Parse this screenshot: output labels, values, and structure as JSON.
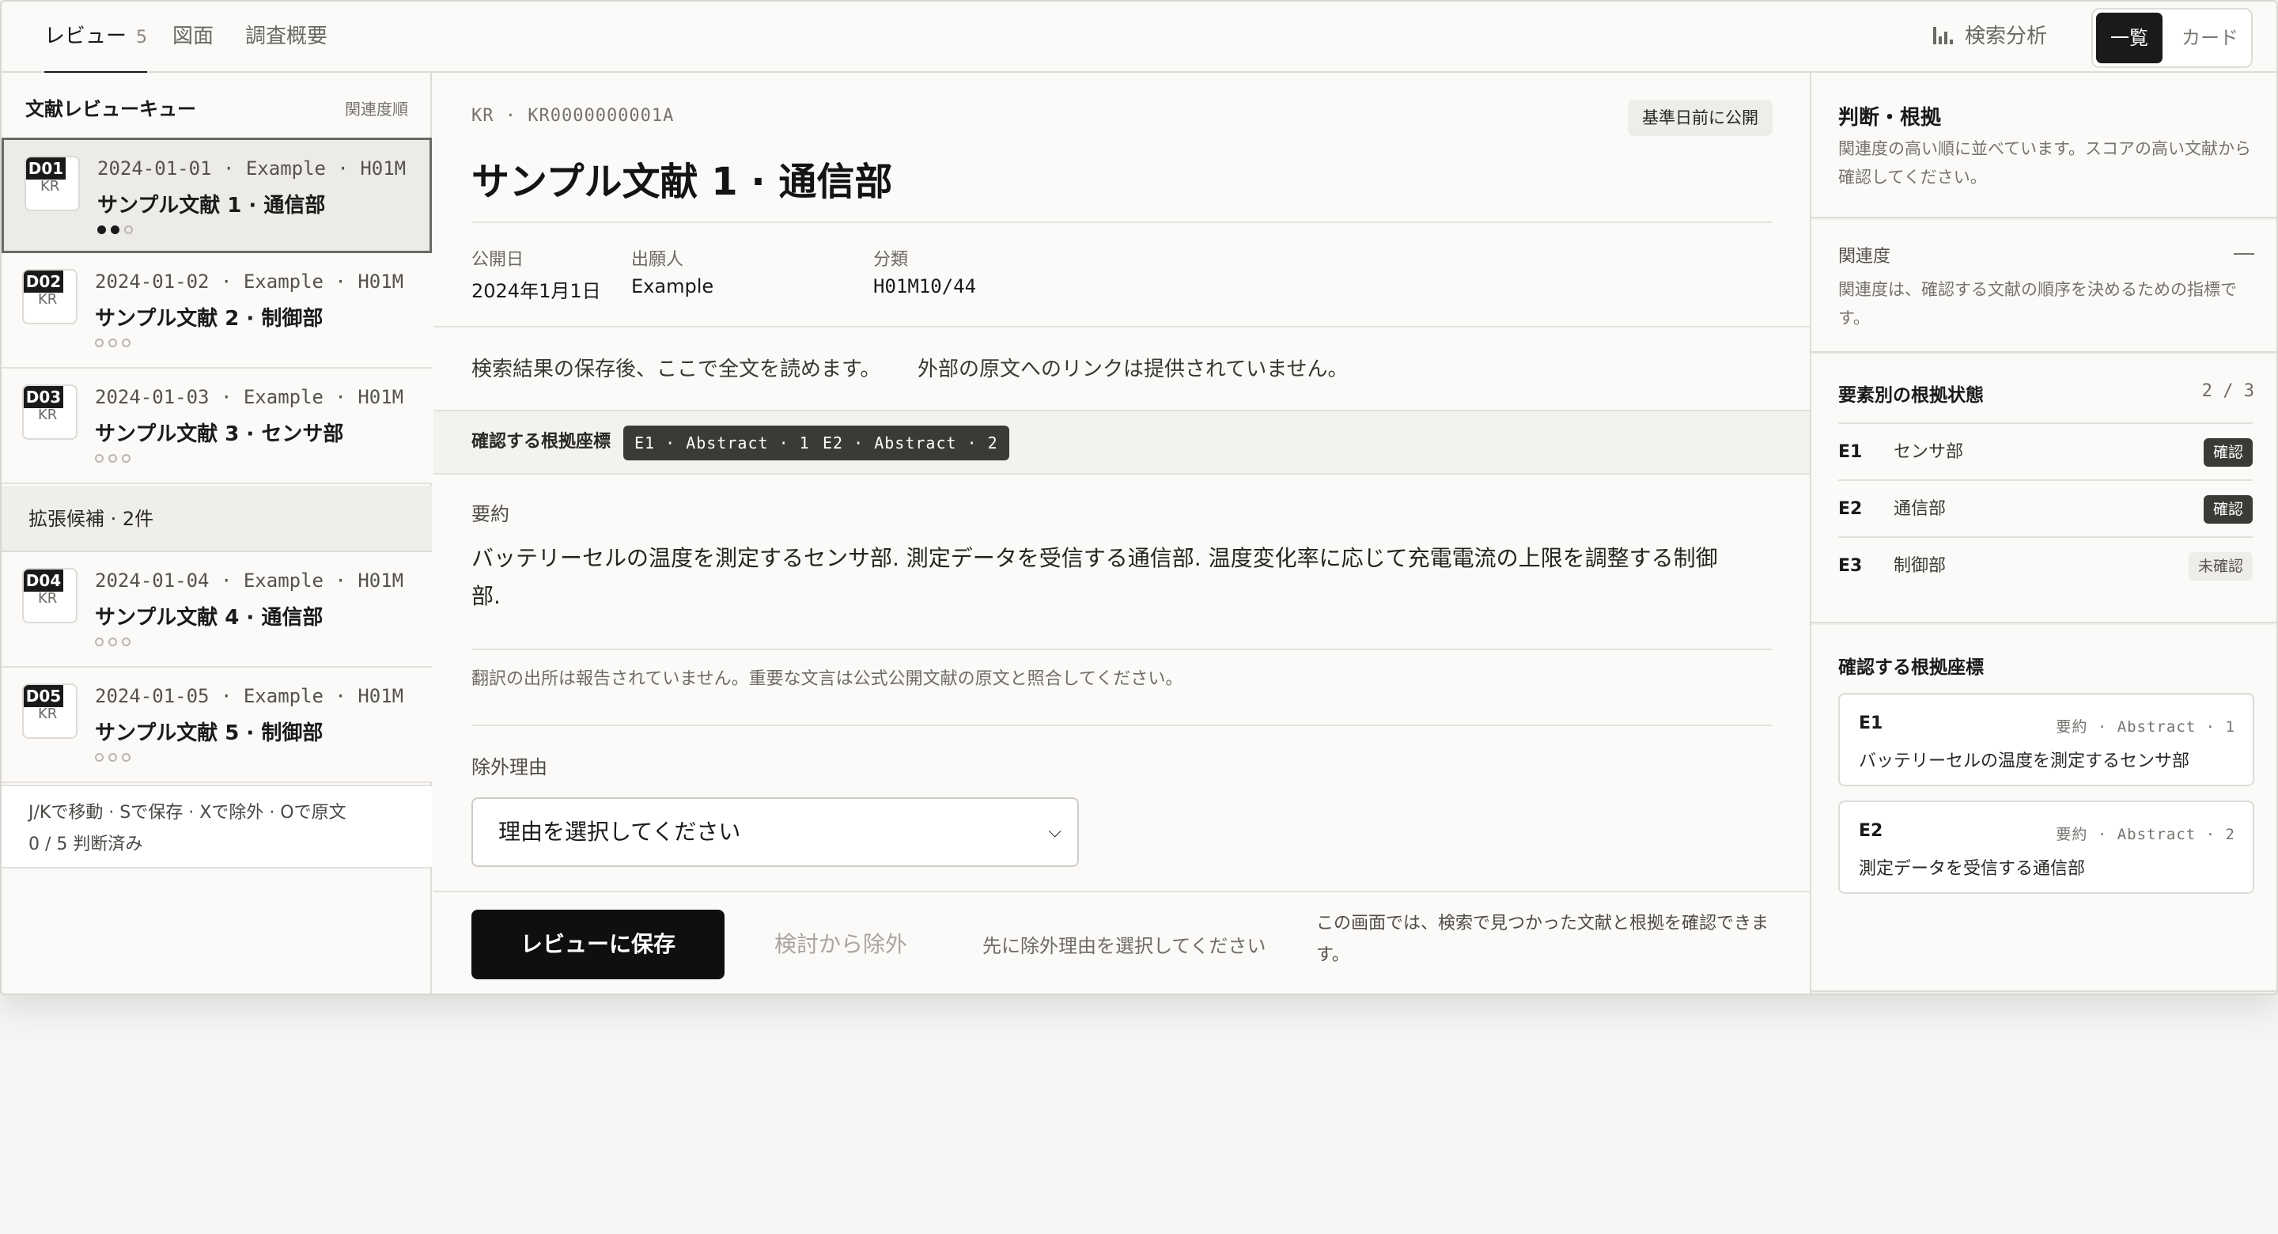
{
  "tabs": [
    {
      "label": "レビュー",
      "count": "5"
    },
    {
      "label": "図面"
    },
    {
      "label": "調査概要"
    }
  ],
  "header": {
    "analysis_label": "検索分析",
    "view_list": "一覧",
    "view_card": "カード"
  },
  "queue": {
    "title": "文献レビューキュー",
    "sort": "関連度順",
    "group_label": "拡張候補 · 2件",
    "items": [
      {
        "code": "D01",
        "country": "KR",
        "meta": "2024-01-01 · Example · H01M",
        "title": "サンプル文献 1 · 通信部",
        "progress": 2,
        "total": 3
      },
      {
        "code": "D02",
        "country": "KR",
        "meta": "2024-01-02 · Example · H01M",
        "title": "サンプル文献 2 · 制御部",
        "progress": 0,
        "total": 3
      },
      {
        "code": "D03",
        "country": "KR",
        "meta": "2024-01-03 · Example · H01M",
        "title": "サンプル文献 3 · センサ部",
        "progress": 0,
        "total": 3
      },
      {
        "code": "D04",
        "country": "KR",
        "meta": "2024-01-04 · Example · H01M",
        "title": "サンプル文献 4 · 通信部",
        "progress": 0,
        "total": 3
      },
      {
        "code": "D05",
        "country": "KR",
        "meta": "2024-01-05 · Example · H01M",
        "title": "サンプル文献 5 · 制御部",
        "progress": 0,
        "total": 3
      }
    ],
    "footer_shortcuts": "J/Kで移動 · Sで保存 · Xで除外 · Oで原文",
    "footer_progress": "0 / 5 判断済み"
  },
  "doc": {
    "crumb": "KR · KR0000000001A",
    "badge": "基準日前に公開",
    "title": "サンプル文献 1 · 通信部",
    "fields": [
      {
        "label": "公開日",
        "value": "2024年1月1日"
      },
      {
        "label": "出願人",
        "value": "Example"
      },
      {
        "label": "分類",
        "value": "H01M10/44"
      }
    ],
    "notice_1": "検索結果の保存後、ここで全文を読めます。",
    "notice_2": "外部の原文へのリンクは提供されていません。",
    "evidence_label": "確認する根拠座標",
    "chips": [
      "E1 · Abstract · 1",
      "E2 · Abstract · 2"
    ],
    "abstract_label": "要約",
    "abstract": "バッテリーセルの温度を測定するセンサ部. 測定データを受信する通信部. 温度変化率に応じて充電電流の上限を調整する制御部.",
    "translation_note": "翻訳の出所は報告されていません。重要な文言は公式公開文献の原文と照合してください。",
    "exclusion_label": "除外理由",
    "exclusion_placeholder": "理由を選択してください"
  },
  "actions": {
    "save": "レビューに保存",
    "exclude": "検討から除外",
    "hint": "先に除外理由を選択してください",
    "note": "この画面では、検索で見つかった文献と根拠を確認できます。"
  },
  "panel": {
    "title": "判断・根拠",
    "subtitle": "関連度の高い順に並べています。スコアの高い文献から確認してください。",
    "relevance_label": "関連度",
    "relevance_desc": "関連度は、確認する文献の順序を決めるための指標です。",
    "elements_title": "要素別の根拠状態",
    "elements_count": "2 / 3",
    "elements": [
      {
        "id": "E1",
        "name": "センサ部",
        "status": "確認",
        "ok": true
      },
      {
        "id": "E2",
        "name": "通信部",
        "status": "確認",
        "ok": true
      },
      {
        "id": "E3",
        "name": "制御部",
        "status": "未確認",
        "ok": false
      }
    ],
    "coords_title": "確認する根拠座標",
    "coords": [
      {
        "id": "E1",
        "source": "要約 · Abstract · 1",
        "text": "バッテリーセルの温度を測定するセンサ部"
      },
      {
        "id": "E2",
        "source": "要約 · Abstract · 2",
        "text": "測定データを受信する通信部"
      }
    ]
  }
}
